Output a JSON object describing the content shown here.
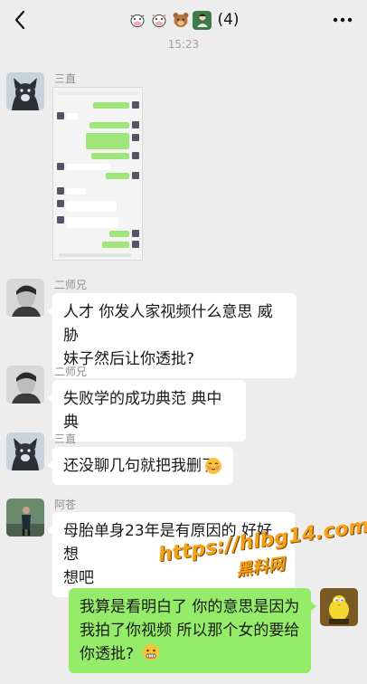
{
  "header": {
    "title_emojis": [
      "cow-emoji",
      "cow-face-emoji",
      "bear-emoji",
      "person-emoji"
    ],
    "member_count": "(4)",
    "back_icon": "chevron-left-icon",
    "more_icon": "ellipsis-icon"
  },
  "timestamp": "15:23",
  "messages": [
    {
      "sender": "三直",
      "type": "image"
    },
    {
      "sender": "二师兄",
      "text_line1": "人才 你发人家视频什么意思 威胁",
      "text_line2": "妹子然后让你透批?"
    },
    {
      "sender": "二师兄",
      "text": "失败学的成功典范 典中典"
    },
    {
      "sender": "三直",
      "text": "还没聊几句就把我删了"
    },
    {
      "sender": "阿苍",
      "text_line1": "母胎单身23年是有原因的 好好想",
      "text_line2": "想吧"
    },
    {
      "sender": "me",
      "text_line1": "我算是看明白了 你的意思是因为",
      "text_line2": "我拍了你视频 所以那个女的要给",
      "text_line3": "你透批?"
    }
  ],
  "watermark": {
    "line1": "https://hlbg14.com",
    "line2": "黑料网"
  },
  "colors": {
    "background": "#ededed",
    "bubble_left": "#ffffff",
    "bubble_right": "#95ec69"
  }
}
